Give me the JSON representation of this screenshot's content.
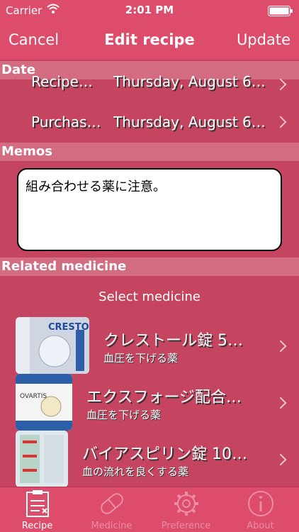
{
  "status": {
    "carrier": "Carrier",
    "time": "2:01 PM"
  },
  "nav": {
    "cancel": "Cancel",
    "title": "Edit recipe",
    "update": "Update"
  },
  "sections": {
    "date": "Date",
    "memos": "Memos",
    "related": "Related medicine"
  },
  "dates": [
    {
      "label": "Recipe…",
      "value": "Thursday, August 6…"
    },
    {
      "label": "Purchas…",
      "value": "Thursday, August 6…"
    }
  ],
  "memo": {
    "text": "組み合わせる薬に注意。"
  },
  "select_medicine": "Select medicine",
  "medicines": [
    {
      "name": "クレストール錠 5…",
      "desc": "血圧を下げる薬",
      "thumb_label": "CRESTO"
    },
    {
      "name": "エクスフォージ配合…",
      "desc": "血圧を下げる薬",
      "thumb_label": "OVARTIS"
    },
    {
      "name": "バイアスピリン錠 10…",
      "desc": "血の流れを良くする薬",
      "thumb_label": ""
    }
  ],
  "tabs": [
    {
      "label": "Recipe",
      "icon": "clipboard-icon",
      "active": true
    },
    {
      "label": "Medicine",
      "icon": "pill-icon",
      "active": false
    },
    {
      "label": "Preference",
      "icon": "gear-icon",
      "active": false
    },
    {
      "label": "About",
      "icon": "info-icon",
      "active": false
    }
  ],
  "colors": {
    "bar": "#dd4c6a",
    "background": "#c5445f",
    "section": "#d36c80",
    "inactive_tab": "#e88fa3"
  }
}
